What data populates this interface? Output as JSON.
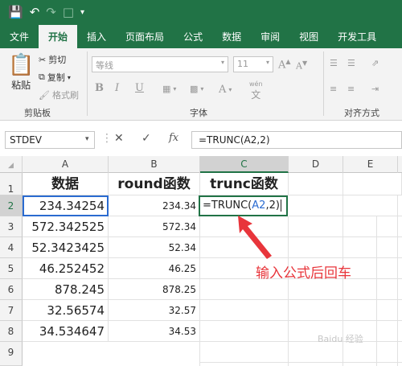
{
  "qat": {
    "save_icon": "save-icon",
    "undo_icon": "undo-icon",
    "redo_icon": "redo-icon",
    "preview_icon": "print-preview-icon",
    "more_icon": "customize-icon"
  },
  "tabs": [
    "文件",
    "开始",
    "插入",
    "页面布局",
    "公式",
    "数据",
    "审阅",
    "视图",
    "开发工具"
  ],
  "active_tab": "开始",
  "ribbon": {
    "paste": "粘贴",
    "cut": "剪切",
    "copy": "复制",
    "format_painter": "格式刷",
    "clipboard_group": "剪贴板",
    "font_name": "等线",
    "font_size": "11",
    "font_group": "字体",
    "align_group": "对齐方式",
    "bold": "B",
    "italic": "I",
    "underline": "U",
    "fontsize_up": "A",
    "fontsize_down": "A",
    "wen": "wén"
  },
  "formula_bar": {
    "name_box": "STDEV",
    "fx": "fx",
    "formula": "=TRUNC(A2,2)"
  },
  "columns": [
    "A",
    "B",
    "C",
    "D",
    "E"
  ],
  "rows": [
    "1",
    "2",
    "3",
    "4",
    "5",
    "6",
    "7",
    "8",
    "9"
  ],
  "headers": {
    "A": "数据",
    "B": "round函数",
    "C": "trunc函数"
  },
  "colA": [
    "234.34254",
    "572.342525",
    "52.3423425",
    "46.252452",
    "878.245",
    "32.56574",
    "34.534647"
  ],
  "colB": [
    "234.34",
    "572.34",
    "52.34",
    "46.25",
    "878.25",
    "32.57",
    "34.53"
  ],
  "editing_cell": {
    "prefix": "=TRUNC(",
    "ref": "A2",
    "suffix": ",2)"
  },
  "annotation": "输入公式后回车",
  "watermark": "Baidu 经验",
  "colors": {
    "excel_green": "#217346",
    "annotation_red": "#e8353b",
    "ref_blue": "#2a6bd0"
  }
}
